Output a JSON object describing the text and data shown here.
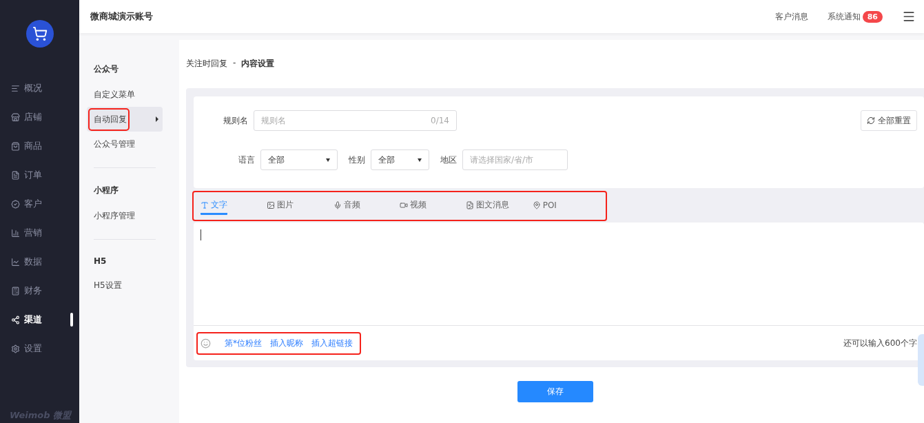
{
  "top_bar": {
    "account": "微商城演示账号",
    "links": [
      {
        "label": "客户消息"
      },
      {
        "label": "系统通知",
        "badge": "86"
      }
    ]
  },
  "main_nav": [
    {
      "label": "概况",
      "kind": "overview",
      "selected": false
    },
    {
      "label": "店铺",
      "kind": "store",
      "selected": false
    },
    {
      "label": "商品",
      "kind": "goods",
      "selected": false
    },
    {
      "label": "订单",
      "kind": "order",
      "selected": false
    },
    {
      "label": "客户",
      "kind": "vip",
      "selected": false
    },
    {
      "label": "营销",
      "kind": "marketing",
      "selected": false
    },
    {
      "label": "数据",
      "kind": "data",
      "selected": false
    },
    {
      "label": "财务",
      "kind": "finance",
      "selected": false
    },
    {
      "label": "渠道",
      "kind": "channel",
      "selected": true
    },
    {
      "label": "设置",
      "kind": "settings",
      "selected": false
    }
  ],
  "footer_logo": "Weimob 微盟",
  "sub_nav": [
    {
      "title": "公众号",
      "items": [
        {
          "label": "自定义菜单",
          "selected": false,
          "highlighted": false
        },
        {
          "label": "自动回复",
          "selected": true,
          "highlighted": true
        },
        {
          "label": "公众号管理",
          "selected": false,
          "highlighted": false
        }
      ]
    },
    {
      "title": "小程序",
      "items": [
        {
          "label": "小程序管理",
          "selected": false,
          "highlighted": false
        }
      ]
    },
    {
      "title": "H5",
      "items": [
        {
          "label": "H5设置",
          "selected": false,
          "highlighted": false
        }
      ]
    }
  ],
  "breadcrumb": {
    "parent": "关注时回复",
    "separator": "-",
    "current": "内容设置"
  },
  "form": {
    "rule_name": {
      "label": "规则名",
      "placeholder": "规则名",
      "counter": "0/14"
    },
    "reset_button": "全部重置",
    "filters": [
      {
        "label": "语言",
        "kind": "select",
        "value": "全部"
      },
      {
        "label": "性别",
        "kind": "select",
        "value": "全部"
      },
      {
        "label": "地区",
        "kind": "input",
        "placeholder": "请选择国家/省/市"
      }
    ]
  },
  "message_tabs": {
    "highlighted": true,
    "items": [
      {
        "label": "文字",
        "kind": "text",
        "selected": true
      },
      {
        "label": "图片",
        "kind": "image",
        "selected": false
      },
      {
        "label": "音频",
        "kind": "audio",
        "selected": false
      },
      {
        "label": "视频",
        "kind": "video",
        "selected": false
      },
      {
        "label": "图文消息",
        "kind": "article",
        "selected": false
      },
      {
        "label": "POI",
        "kind": "poi",
        "selected": false
      }
    ]
  },
  "editor_toolbar": {
    "highlighted": true,
    "links": [
      "第*位粉丝",
      "插入昵称",
      "插入超链接"
    ],
    "remaining": "还可以输入600个字"
  },
  "save_button": "保存"
}
